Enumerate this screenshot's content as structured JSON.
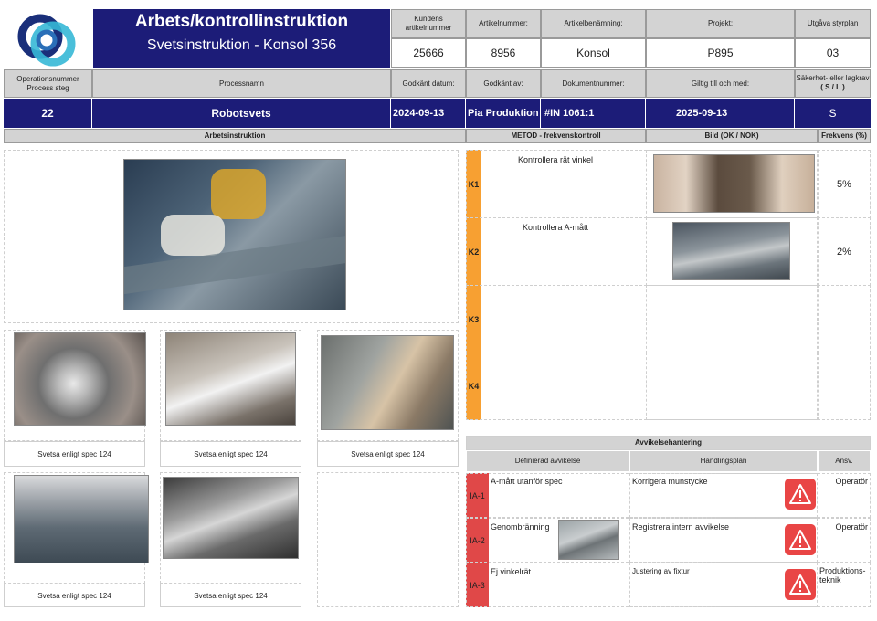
{
  "header": {
    "title": "Arbets/kontrollinstruktion",
    "subtitle": "Svetsinstruktion - Konsol 356",
    "labels": {
      "customer_article": "Kundens artikelnummer",
      "article_number": "Artikelnummer:",
      "article_name": "Artikelbenämning:",
      "project": "Projekt:",
      "edition": "Utgåva styrplan",
      "operation_number": "Operationsnummer Process steg",
      "process_name": "Processnamn",
      "approved_date": "Godkänt datum:",
      "approved_by": "Godkänt av:",
      "document_number": "Dokumentnummer:",
      "valid_until": "Giltig till och med:",
      "safety_req": "Säkerhet- eller lagkrav",
      "safety_code": "( S / L )"
    },
    "values": {
      "customer_article": "25666",
      "article_number": "8956",
      "article_name": "Konsol",
      "project": "P895",
      "edition": "03",
      "operation_number": "22",
      "process_name": "Robotsvets",
      "approved_date": "2024-09-13",
      "approved_by": "Pia Produktion",
      "document_number": "#IN 1061:1",
      "valid_until": "2025-09-13",
      "safety": "S"
    }
  },
  "sections": {
    "work_instruction": "Arbetsinstruktion",
    "method": "METOD - frekvenskontroll",
    "image": "Bild (OK / NOK)",
    "frequency": "Frekvens (%)"
  },
  "captions": [
    "Svetsa  enligt spec 124",
    "Svetsa  enligt spec 124",
    "Svetsa  enligt spec 124",
    "Svetsa  enligt spec 124",
    "Svetsa  enligt spec 124"
  ],
  "controls": [
    {
      "code": "K1",
      "method": "Kontrollera  rät vinkel",
      "frequency": "5%"
    },
    {
      "code": "K2",
      "method": "Kontrollera  A-mått",
      "frequency": "2%"
    },
    {
      "code": "K3",
      "method": "",
      "frequency": ""
    },
    {
      "code": "K4",
      "method": "",
      "frequency": ""
    }
  ],
  "deviation": {
    "title": "Avvikelsehantering",
    "col_defined": "Definierad avvikelse",
    "col_plan": "Handlingsplan",
    "col_resp": "Ansv.",
    "rows": [
      {
        "code": "IA-1",
        "defined": "A-mått utanför spec",
        "plan": "Korrigera munstycke",
        "resp": "Operatör"
      },
      {
        "code": "IA-2",
        "defined": "Genombränning",
        "plan": "Registrera intern avvikelse",
        "resp": "Operatör"
      },
      {
        "code": "IA-3",
        "defined": "Ej vinkelrät",
        "plan": "Justering av fixtur",
        "resp": "Produktions-teknik"
      }
    ]
  },
  "colors": {
    "navy": "#1c1c78",
    "orange": "#f7a032",
    "red": "#e04848",
    "warning": "#e94545"
  },
  "icons": {
    "logo": "interlocking-rings-logo",
    "warning": "warning-triangle-icon"
  }
}
